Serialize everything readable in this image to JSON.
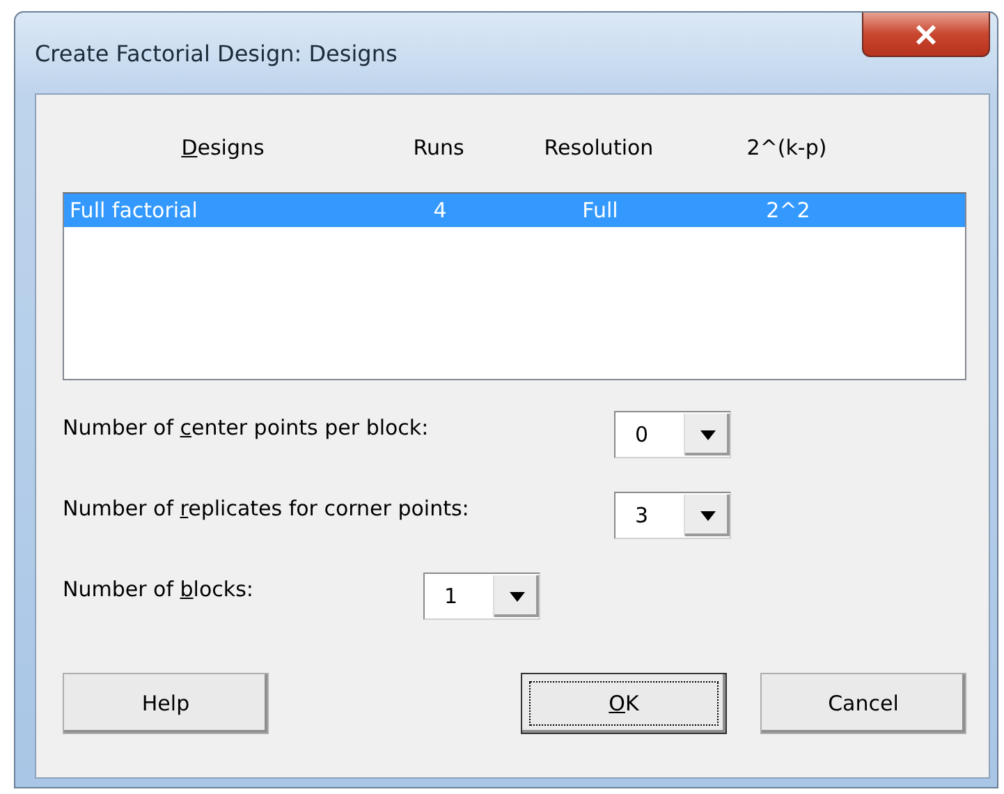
{
  "window": {
    "title": "Create Factorial Design: Designs"
  },
  "designs_table": {
    "columns": [
      {
        "label_parts": [
          {
            "text": "D",
            "underlined": true
          },
          {
            "text": "esigns",
            "underlined": false
          }
        ]
      },
      {
        "label_parts": [
          {
            "text": "Runs",
            "underlined": false
          }
        ]
      },
      {
        "label_parts": [
          {
            "text": "Resolution",
            "underlined": false
          }
        ]
      },
      {
        "label_parts": [
          {
            "text": "2^(k-p)",
            "underlined": false
          }
        ]
      }
    ],
    "rows": [
      {
        "cells": [
          "Full factorial",
          "4",
          "Full",
          "2^2"
        ],
        "selected": true
      }
    ]
  },
  "fields": [
    {
      "label_parts": [
        {
          "text": "Number of ",
          "underlined": false
        },
        {
          "text": "c",
          "underlined": true
        },
        {
          "text": "enter points per block:",
          "underlined": false
        }
      ],
      "value": "0",
      "kind": "wide"
    },
    {
      "label_parts": [
        {
          "text": "Number of ",
          "underlined": false
        },
        {
          "text": "r",
          "underlined": true
        },
        {
          "text": "eplicates for corner points:",
          "underlined": false
        }
      ],
      "value": "3",
      "kind": "wide"
    },
    {
      "label_parts": [
        {
          "text": "Number of ",
          "underlined": false
        },
        {
          "text": "b",
          "underlined": true
        },
        {
          "text": "locks:",
          "underlined": false
        }
      ],
      "value": "1",
      "kind": "narrow"
    }
  ],
  "buttons": [
    {
      "label_parts": [
        {
          "text": "Help",
          "underlined": false
        }
      ],
      "focused": false
    },
    {
      "label_parts": [
        {
          "text": "O",
          "underlined": true
        },
        {
          "text": "K",
          "underlined": false
        }
      ],
      "focused": true
    },
    {
      "label_parts": [
        {
          "text": "Cancel",
          "underlined": false
        }
      ],
      "focused": false
    }
  ]
}
